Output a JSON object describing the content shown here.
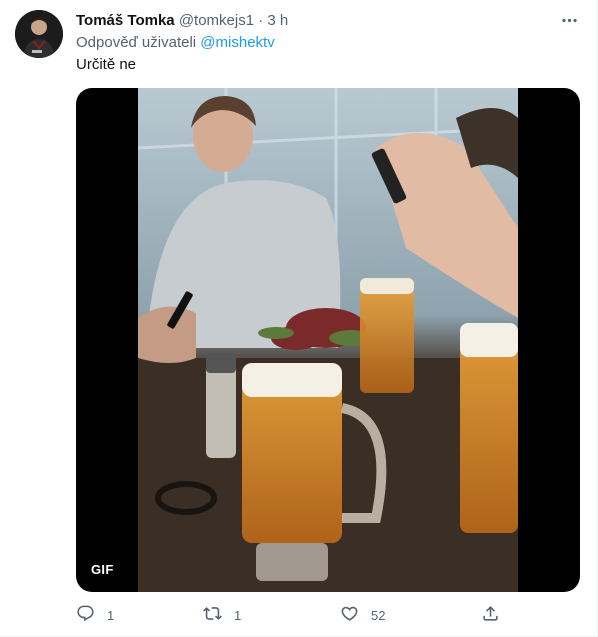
{
  "tweet": {
    "author_name": "Tomáš Tomka",
    "author_handle": "@tomkejs1",
    "separator": "·",
    "time": "3 h",
    "reply_prefix": "Odpověď uživateli",
    "reply_mention": "@mishektv",
    "text": "Určitě ne",
    "media": {
      "type": "gif",
      "badge": "GIF"
    },
    "actions": {
      "reply_count": "1",
      "retweet_count": "1",
      "like_count": "52"
    }
  },
  "colors": {
    "accent": "#1d9bf0",
    "secondary_text": "#536471",
    "primary_text": "#0f1419"
  },
  "icons": [
    "more-icon",
    "reply-icon",
    "retweet-icon",
    "like-icon",
    "share-icon"
  ]
}
